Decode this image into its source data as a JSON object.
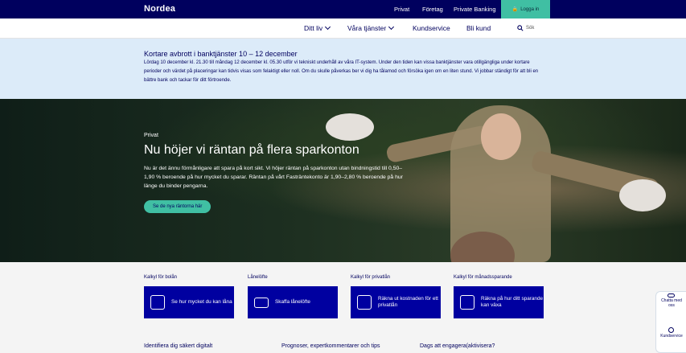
{
  "brand": {
    "logo": "Nordea",
    "primary": "#00005e",
    "accent": "#40bfa3",
    "button_blue": "#0000a0"
  },
  "topnav": {
    "items": [
      "Privat",
      "Företag",
      "Private Banking"
    ],
    "login": "Logga in",
    "login_icon": "lock-icon"
  },
  "mainnav": {
    "items": [
      "Ditt liv",
      "Våra tjänster",
      "Kundservice",
      "Bli kund"
    ],
    "search_label": "Sök",
    "search_icon": "search-icon"
  },
  "notice": {
    "title": "Kortare avbrott i banktjänster 10 – 12 december",
    "body": "Lördag 10 december kl. 21.30 till måndag 12 december kl. 05.30 utför vi tekniskt underhåll av våra IT-system. Under den tiden kan vissa banktjänster vara otillgängliga under kortare perioder och värdet på placeringar kan tidvis visas som felaktigt eller noll. Om du skulle påverkas ber vi dig ha tålamod och försöka igen om en liten stund. Vi jobbar ständigt för att bli en bättre bank och tackar för ditt förtroende."
  },
  "hero": {
    "eyebrow": "Privat",
    "title": "Nu höjer vi räntan på flera sparkonton",
    "lead": "Nu är det ännu förmånligare att spara på kort sikt. Vi höjer räntan på sparkonton utan bindningstid till 0,50–1,90 % beroende på hur mycket du sparar. Räntan på vårt Fasträntekonto är 1,90–2,80 % beroende på hur länge du binder pengarna.",
    "cta": "Se de nya räntorna här"
  },
  "tools": [
    {
      "label": "Kalkyl för bolån",
      "card": "Se hur mycket du kan låna",
      "icon": "coins-icon"
    },
    {
      "label": "Lånelöfte",
      "card": "Skaffa lånelöfte",
      "icon": "laptop-icon"
    },
    {
      "label": "Kalkyl för privatlån",
      "card": "Räkna ut kostnaden för ett privatlån",
      "icon": "calculator-icon"
    },
    {
      "label": "Kalkyl för månadssparande",
      "card": "Räkna på hur ditt sparande kan växa",
      "icon": "calculator-icon"
    }
  ],
  "sections": [
    "Identifiera dig säkert digitalt",
    "Prognoser, expertkommentarer och tips",
    "Dags att engagera(aktivisera?"
  ],
  "side_widget": {
    "chat": "Chatta med oss",
    "contact": "Kundservice"
  }
}
